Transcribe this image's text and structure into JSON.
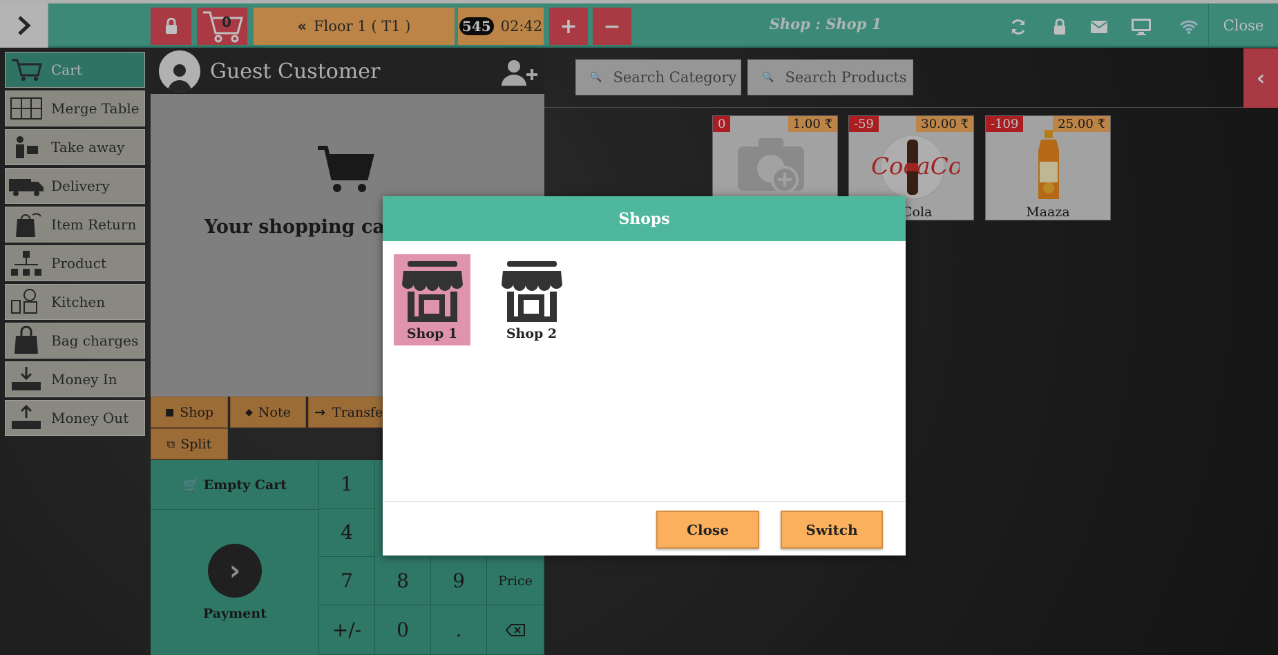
{
  "topbar": {
    "cart_count": "0",
    "floor_label": "Floor 1 ( T1 )",
    "order_badge": "545",
    "timer": "02:42",
    "shop_title": "Shop : Shop 1",
    "close_label": "Close"
  },
  "sidebar": {
    "items": [
      {
        "label": "Cart",
        "icon": "cart-icon"
      },
      {
        "label": "Merge Table",
        "icon": "merge-table-icon"
      },
      {
        "label": "Take away",
        "icon": "takeaway-icon"
      },
      {
        "label": "Delivery",
        "icon": "delivery-truck-icon"
      },
      {
        "label": "Item Return",
        "icon": "item-return-icon"
      },
      {
        "label": "Product",
        "icon": "product-icon"
      },
      {
        "label": "Kitchen",
        "icon": "kitchen-icon"
      },
      {
        "label": "Bag charges",
        "icon": "bag-icon"
      },
      {
        "label": "Money In",
        "icon": "money-in-icon"
      },
      {
        "label": "Money Out",
        "icon": "money-out-icon"
      }
    ]
  },
  "customer": {
    "name": "Guest Customer"
  },
  "cart": {
    "empty_message": "Your shopping cart"
  },
  "actions": {
    "shop": "Shop",
    "note": "Note",
    "transfer": "Transfer",
    "split": "Split"
  },
  "keypad": {
    "empty_cart": "Empty Cart",
    "payment": "Payment",
    "keys": [
      "1",
      "4",
      "7",
      "8",
      "9",
      "Price",
      "+/-",
      "0",
      "."
    ]
  },
  "search": {
    "category": "Search Category",
    "products": "Search Products"
  },
  "products": [
    {
      "stock": "0",
      "price": "1.00 ₹",
      "name": ""
    },
    {
      "stock": "-59",
      "price": "30.00 ₹",
      "name": "a Cola"
    },
    {
      "stock": "-109",
      "price": "25.00 ₹",
      "name": "Maaza"
    }
  ],
  "modal": {
    "title": "Shops",
    "shops": [
      {
        "label": "Shop 1",
        "selected": true
      },
      {
        "label": "Shop 2",
        "selected": false
      }
    ],
    "close_label": "Close",
    "switch_label": "Switch"
  },
  "colors": {
    "accent": "#4fb79e",
    "danger": "#e24d59",
    "warning": "#fbb05e",
    "selected": "#df93ad"
  }
}
